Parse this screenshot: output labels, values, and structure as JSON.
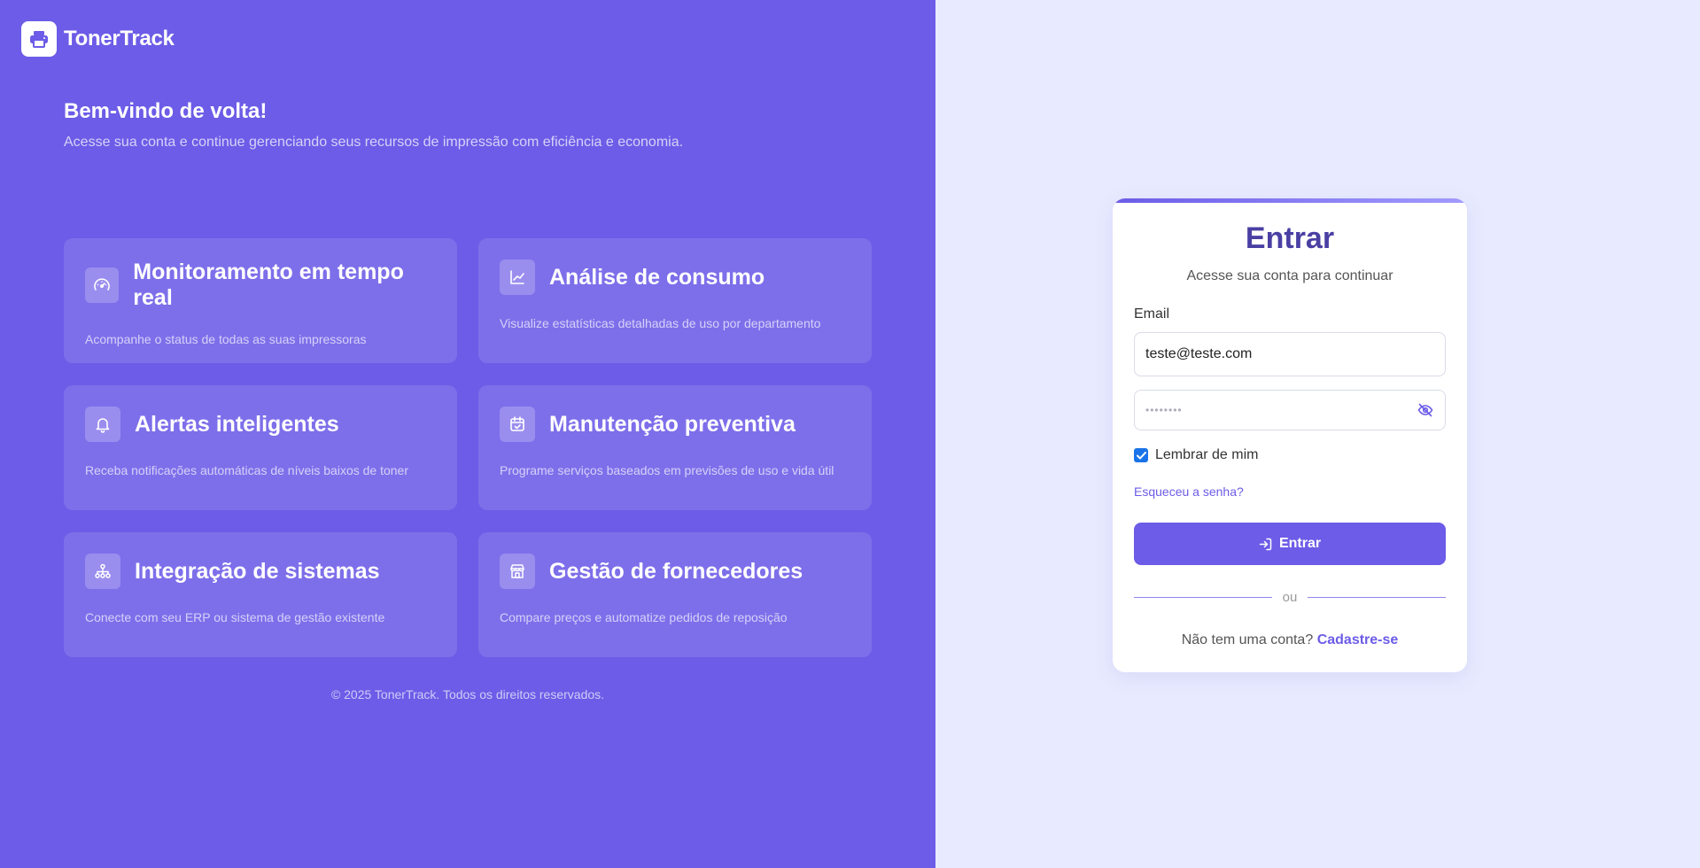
{
  "brand": {
    "name": "TonerTrack"
  },
  "welcome": {
    "title": "Bem-vindo de volta!",
    "subtitle": "Acesse sua conta e continue gerenciando seus recursos de impressão com eficiência e economia."
  },
  "features": [
    {
      "title": "Monitoramento em tempo real",
      "desc": "Acompanhe o status de todas as suas impressoras",
      "icon": "gauge-icon"
    },
    {
      "title": "Análise de consumo",
      "desc": "Visualize estatísticas detalhadas de uso por departamento",
      "icon": "chart-line-icon"
    },
    {
      "title": "Alertas inteligentes",
      "desc": "Receba notificações automáticas de níveis baixos de toner",
      "icon": "bell-icon"
    },
    {
      "title": "Manutenção preventiva",
      "desc": "Programe serviços baseados em previsões de uso e vida útil",
      "icon": "calendar-check-icon"
    },
    {
      "title": "Integração de sistemas",
      "desc": "Conecte com seu ERP ou sistema de gestão existente",
      "icon": "sitemap-icon"
    },
    {
      "title": "Gestão de fornecedores",
      "desc": "Compare preços e automatize pedidos de reposição",
      "icon": "store-icon"
    }
  ],
  "footer": {
    "copyright": "© 2025 TonerTrack. Todos os direitos reservados."
  },
  "login": {
    "title": "Entrar",
    "subtitle": "Acesse sua conta para continuar",
    "email_label": "Email",
    "email_value": "teste@teste.com",
    "password_mask": "••••••••",
    "remember_label": "Lembrar de mim",
    "remember_checked": true,
    "forgot_label": "Esqueceu a senha?",
    "submit_label": "Entrar",
    "divider_label": "ou",
    "signup_prompt": "Não tem uma conta?",
    "signup_link": "Cadastre-se"
  },
  "colors": {
    "primary": "#6c5ce7",
    "panel_bg": "#e8ebff",
    "title": "#4a3fa3",
    "checkbox": "#1a73e8"
  }
}
